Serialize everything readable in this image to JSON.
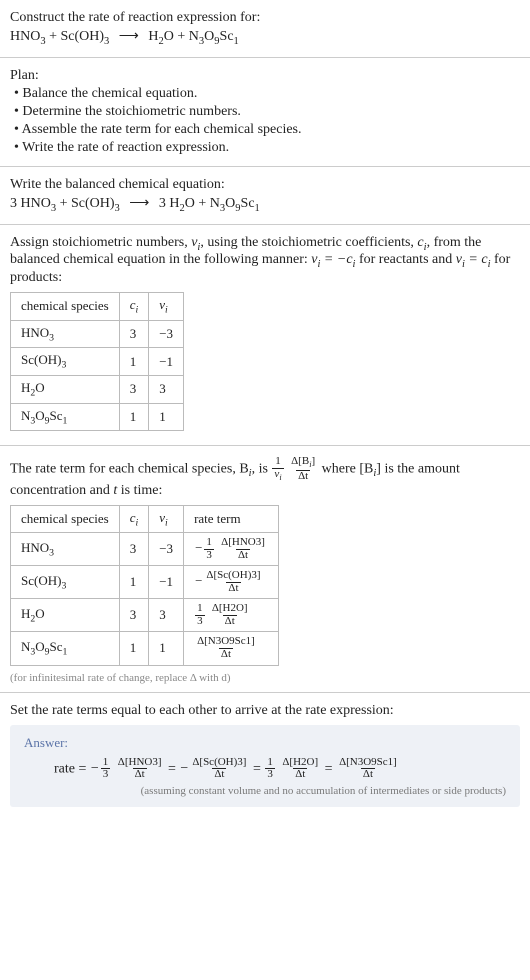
{
  "header": {
    "prompt": "Construct the rate of reaction expression for:"
  },
  "equation_unbalanced": {
    "lhs1": "HNO",
    "lhs1_sub": "3",
    "plus1": " + ",
    "lhs2": "Sc(OH)",
    "lhs2_sub": "3",
    "arrow": "⟶",
    "rhs1": "H",
    "rhs1_sub": "2",
    "rhs1b": "O",
    "plus2": " + ",
    "rhs2": "N",
    "rhs2_sub": "3",
    "rhs2b": "O",
    "rhs2b_sub": "9",
    "rhs2c": "Sc",
    "rhs2c_sub": "1"
  },
  "plan": {
    "title": "Plan:",
    "b1": "• Balance the chemical equation.",
    "b2": "• Determine the stoichiometric numbers.",
    "b3": "• Assemble the rate term for each chemical species.",
    "b4": "• Write the rate of reaction expression."
  },
  "balanced": {
    "title": "Write the balanced chemical equation:",
    "c1": "3 ",
    "lhs1": "HNO",
    "lhs1_sub": "3",
    "plus1": " + ",
    "lhs2": "Sc(OH)",
    "lhs2_sub": "3",
    "arrow": "⟶",
    "c2": "3 ",
    "rhs1": "H",
    "rhs1_sub": "2",
    "rhs1b": "O",
    "plus2": " + ",
    "rhs2": "N",
    "rhs2_sub": "3",
    "rhs2b": "O",
    "rhs2b_sub": "9",
    "rhs2c": "Sc",
    "rhs2c_sub": "1"
  },
  "stoich_intro": {
    "t1": "Assign stoichiometric numbers, ",
    "t2": ", using the stoichiometric coefficients, ",
    "t3": ", from the balanced chemical equation in the following manner: ",
    "t4": " for reactants and ",
    "t5": " for products:",
    "nu": "ν",
    "nu_sub": "i",
    "c": "c",
    "c_sub": "i",
    "eq1a": "ν",
    "eq1b": "i",
    "eq1c": " = −c",
    "eq1d": "i",
    "eq2a": "ν",
    "eq2b": "i",
    "eq2c": " = c",
    "eq2d": "i"
  },
  "table1": {
    "h1": "chemical species",
    "h2": "c",
    "h2_sub": "i",
    "h3": "ν",
    "h3_sub": "i",
    "rows": [
      {
        "sp_a": "HNO",
        "sp_as": "3",
        "sp_b": "",
        "sp_bs": "",
        "sp_c": "",
        "sp_cs": "",
        "c": "3",
        "nu": "−3"
      },
      {
        "sp_a": "Sc(OH)",
        "sp_as": "3",
        "sp_b": "",
        "sp_bs": "",
        "sp_c": "",
        "sp_cs": "",
        "c": "1",
        "nu": "−1"
      },
      {
        "sp_a": "H",
        "sp_as": "2",
        "sp_b": "O",
        "sp_bs": "",
        "sp_c": "",
        "sp_cs": "",
        "c": "3",
        "nu": "3"
      },
      {
        "sp_a": "N",
        "sp_as": "3",
        "sp_b": "O",
        "sp_bs": "9",
        "sp_c": "Sc",
        "sp_cs": "1",
        "c": "1",
        "nu": "1"
      }
    ]
  },
  "rateterm_intro": {
    "t1": "The rate term for each chemical species, B",
    "t1s": "i",
    "t2": ", is ",
    "frac1_num": "1",
    "frac1_den_a": "ν",
    "frac1_den_b": "i",
    "frac2_num": "Δ[B",
    "frac2_num_s": "i",
    "frac2_num_end": "]",
    "frac2_den": "Δt",
    "t3": " where [B",
    "t3s": "i",
    "t4": "] is the amount concentration and ",
    "t5": "t",
    "t6": " is time:"
  },
  "table2": {
    "h1": "chemical species",
    "h2": "c",
    "h2_sub": "i",
    "h3": "ν",
    "h3_sub": "i",
    "h4": "rate term",
    "rows": [
      {
        "sp_a": "HNO",
        "sp_as": "3",
        "sp_b": "",
        "sp_bs": "",
        "sp_c": "",
        "sp_cs": "",
        "c": "3",
        "nu": "−3",
        "neg": "−",
        "f1n": "1",
        "f1d": "3",
        "f2n": "Δ[HNO3]",
        "f2d": "Δt"
      },
      {
        "sp_a": "Sc(OH)",
        "sp_as": "3",
        "sp_b": "",
        "sp_bs": "",
        "sp_c": "",
        "sp_cs": "",
        "c": "1",
        "nu": "−1",
        "neg": "−",
        "f1n": "",
        "f1d": "",
        "f2n": "Δ[Sc(OH)3]",
        "f2d": "Δt"
      },
      {
        "sp_a": "H",
        "sp_as": "2",
        "sp_b": "O",
        "sp_bs": "",
        "sp_c": "",
        "sp_cs": "",
        "c": "3",
        "nu": "3",
        "neg": "",
        "f1n": "1",
        "f1d": "3",
        "f2n": "Δ[H2O]",
        "f2d": "Δt"
      },
      {
        "sp_a": "N",
        "sp_as": "3",
        "sp_b": "O",
        "sp_bs": "9",
        "sp_c": "Sc",
        "sp_cs": "1",
        "c": "1",
        "nu": "1",
        "neg": "",
        "f1n": "",
        "f1d": "",
        "f2n": "Δ[N3O9Sc1]",
        "f2d": "Δt"
      }
    ],
    "note": "(for infinitesimal rate of change, replace Δ with d)"
  },
  "final": {
    "intro": "Set the rate terms equal to each other to arrive at the rate expression:",
    "answer_label": "Answer:",
    "rate": "rate = ",
    "neg": "−",
    "eq": " = ",
    "f1n": "1",
    "f1d": "3",
    "hno3_n": "Δ[HNO3]",
    "hno3_d": "Δt",
    "scoh_n": "Δ[Sc(OH)3]",
    "scoh_d": "Δt",
    "h2o_n": "Δ[H2O]",
    "h2o_d": "Δt",
    "prod_n": "Δ[N3O9Sc1]",
    "prod_d": "Δt",
    "note": "(assuming constant volume and no accumulation of intermediates or side products)"
  }
}
